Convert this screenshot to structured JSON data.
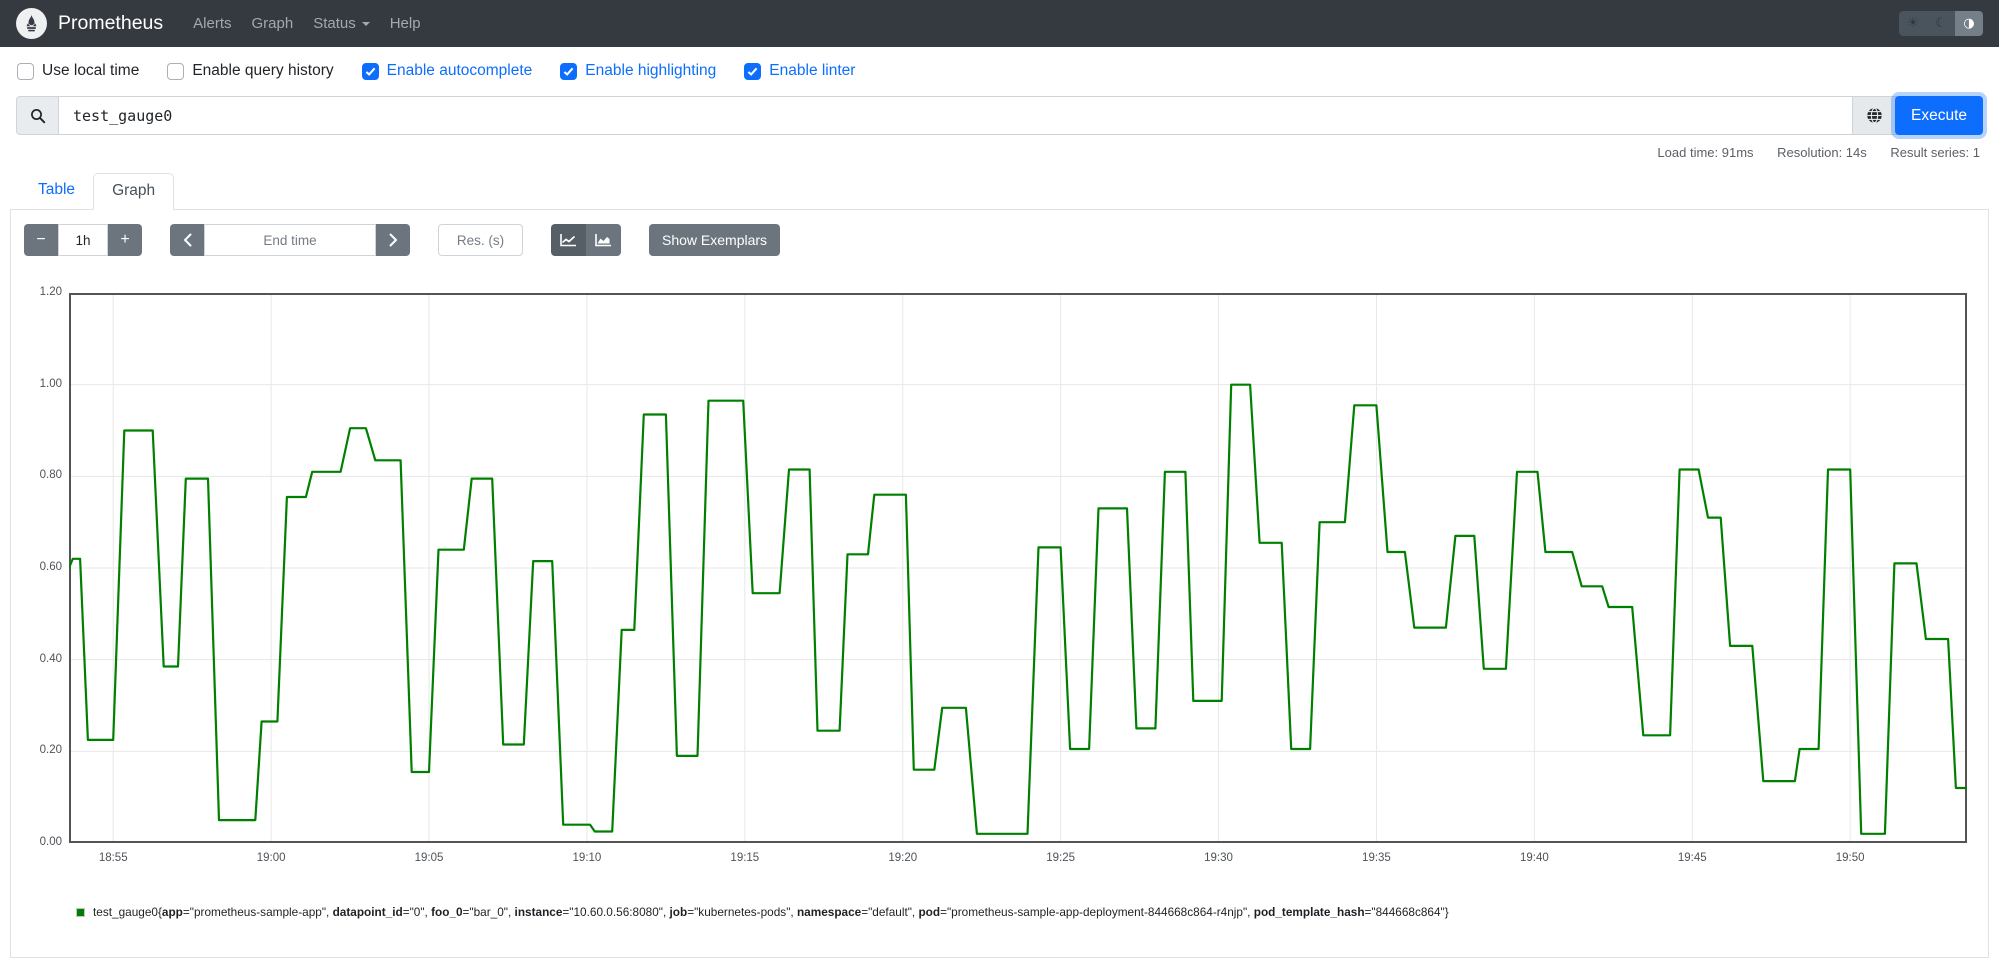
{
  "navbar": {
    "brand": "Prometheus",
    "links": [
      {
        "label": "Alerts"
      },
      {
        "label": "Graph"
      },
      {
        "label": "Status",
        "has_dropdown": true
      },
      {
        "label": "Help"
      }
    ],
    "theme_toggle": {
      "light": "☀",
      "dark": "☾",
      "auto": "◑",
      "active": "auto"
    }
  },
  "toolbar": {
    "checkboxes": [
      {
        "label": "Use local time",
        "checked": false
      },
      {
        "label": "Enable query history",
        "checked": false
      },
      {
        "label": "Enable autocomplete",
        "checked": true
      },
      {
        "label": "Enable highlighting",
        "checked": true
      },
      {
        "label": "Enable linter",
        "checked": true
      }
    ]
  },
  "query": {
    "value": "test_gauge0",
    "execute_label": "Execute"
  },
  "stats": {
    "load_time": "Load time: 91ms",
    "resolution": "Resolution: 14s",
    "result_series": "Result series: 1"
  },
  "tabs": [
    {
      "label": "Table",
      "active": false
    },
    {
      "label": "Graph",
      "active": true
    }
  ],
  "graph_controls": {
    "minus": "−",
    "duration": "1h",
    "plus": "+",
    "end_time_placeholder": "End time",
    "res_placeholder": "Res. (s)",
    "show_exemplars": "Show Exemplars"
  },
  "legend": {
    "metric": "test_gauge0",
    "labels": [
      {
        "name": "app",
        "value": "prometheus-sample-app"
      },
      {
        "name": "datapoint_id",
        "value": "0"
      },
      {
        "name": "foo_0",
        "value": "bar_0"
      },
      {
        "name": "instance",
        "value": "10.60.0.56:8080"
      },
      {
        "name": "job",
        "value": "kubernetes-pods"
      },
      {
        "name": "namespace",
        "value": "default"
      },
      {
        "name": "pod",
        "value": "prometheus-sample-app-deployment-844668c864-r4njp"
      },
      {
        "name": "pod_template_hash",
        "value": "844668c864"
      }
    ]
  },
  "chart_data": {
    "type": "line",
    "style": "step-gauge",
    "series_name": "test_gauge0",
    "series_color": "#008000",
    "x_time_origin": "18:53",
    "x_range": [
      0.6,
      60.7
    ],
    "y_range": [
      0,
      1.2
    ],
    "y_tick_step": 0.2,
    "grid": true,
    "x_ticks": [
      {
        "t": 2,
        "label": "18:55"
      },
      {
        "t": 7,
        "label": "19:00"
      },
      {
        "t": 12,
        "label": "19:05"
      },
      {
        "t": 17,
        "label": "19:10"
      },
      {
        "t": 22,
        "label": "19:15"
      },
      {
        "t": 27,
        "label": "19:20"
      },
      {
        "t": 32,
        "label": "19:25"
      },
      {
        "t": 37,
        "label": "19:30"
      },
      {
        "t": 42,
        "label": "19:35"
      },
      {
        "t": 47,
        "label": "19:40"
      },
      {
        "t": 52,
        "label": "19:45"
      },
      {
        "t": 57,
        "label": "19:50"
      }
    ],
    "points": [
      [
        0.6,
        0.6
      ],
      [
        0.72,
        0.62
      ],
      [
        0.95,
        0.62
      ],
      [
        1.2,
        0.225
      ],
      [
        2.0,
        0.225
      ],
      [
        2.35,
        0.9
      ],
      [
        3.25,
        0.9
      ],
      [
        3.6,
        0.385
      ],
      [
        4.05,
        0.385
      ],
      [
        4.3,
        0.795
      ],
      [
        5.0,
        0.795
      ],
      [
        5.35,
        0.05
      ],
      [
        6.5,
        0.05
      ],
      [
        6.7,
        0.265
      ],
      [
        7.2,
        0.265
      ],
      [
        7.5,
        0.755
      ],
      [
        8.1,
        0.755
      ],
      [
        8.3,
        0.81
      ],
      [
        9.2,
        0.81
      ],
      [
        9.5,
        0.905
      ],
      [
        10.0,
        0.905
      ],
      [
        10.3,
        0.835
      ],
      [
        11.1,
        0.835
      ],
      [
        11.45,
        0.155
      ],
      [
        12.0,
        0.155
      ],
      [
        12.3,
        0.64
      ],
      [
        13.1,
        0.64
      ],
      [
        13.35,
        0.795
      ],
      [
        14.0,
        0.795
      ],
      [
        14.35,
        0.215
      ],
      [
        15.0,
        0.215
      ],
      [
        15.3,
        0.615
      ],
      [
        15.9,
        0.615
      ],
      [
        16.25,
        0.04
      ],
      [
        17.1,
        0.04
      ],
      [
        17.25,
        0.025
      ],
      [
        17.8,
        0.025
      ],
      [
        18.1,
        0.465
      ],
      [
        18.5,
        0.465
      ],
      [
        18.8,
        0.935
      ],
      [
        19.5,
        0.935
      ],
      [
        19.85,
        0.19
      ],
      [
        20.5,
        0.19
      ],
      [
        20.85,
        0.965
      ],
      [
        21.95,
        0.965
      ],
      [
        22.25,
        0.545
      ],
      [
        23.1,
        0.545
      ],
      [
        23.4,
        0.815
      ],
      [
        24.05,
        0.815
      ],
      [
        24.3,
        0.245
      ],
      [
        25.0,
        0.245
      ],
      [
        25.25,
        0.63
      ],
      [
        25.9,
        0.63
      ],
      [
        26.1,
        0.76
      ],
      [
        27.1,
        0.76
      ],
      [
        27.35,
        0.16
      ],
      [
        28.0,
        0.16
      ],
      [
        28.25,
        0.295
      ],
      [
        29.0,
        0.295
      ],
      [
        29.35,
        0.02
      ],
      [
        30.95,
        0.02
      ],
      [
        31.3,
        0.645
      ],
      [
        32.0,
        0.645
      ],
      [
        32.3,
        0.205
      ],
      [
        32.9,
        0.205
      ],
      [
        33.2,
        0.73
      ],
      [
        34.1,
        0.73
      ],
      [
        34.4,
        0.25
      ],
      [
        35.0,
        0.25
      ],
      [
        35.3,
        0.81
      ],
      [
        35.95,
        0.81
      ],
      [
        36.2,
        0.31
      ],
      [
        37.1,
        0.31
      ],
      [
        37.4,
        1.0
      ],
      [
        38.0,
        1.0
      ],
      [
        38.3,
        0.655
      ],
      [
        39.0,
        0.655
      ],
      [
        39.3,
        0.205
      ],
      [
        39.9,
        0.205
      ],
      [
        40.2,
        0.7
      ],
      [
        41.0,
        0.7
      ],
      [
        41.3,
        0.955
      ],
      [
        42.0,
        0.955
      ],
      [
        42.35,
        0.635
      ],
      [
        42.9,
        0.635
      ],
      [
        43.2,
        0.47
      ],
      [
        44.2,
        0.47
      ],
      [
        44.5,
        0.67
      ],
      [
        45.1,
        0.67
      ],
      [
        45.4,
        0.38
      ],
      [
        46.1,
        0.38
      ],
      [
        46.45,
        0.81
      ],
      [
        47.1,
        0.81
      ],
      [
        47.35,
        0.635
      ],
      [
        48.2,
        0.635
      ],
      [
        48.5,
        0.56
      ],
      [
        49.15,
        0.56
      ],
      [
        49.35,
        0.515
      ],
      [
        50.1,
        0.515
      ],
      [
        50.45,
        0.235
      ],
      [
        51.3,
        0.235
      ],
      [
        51.6,
        0.815
      ],
      [
        52.2,
        0.815
      ],
      [
        52.5,
        0.71
      ],
      [
        52.9,
        0.71
      ],
      [
        53.2,
        0.43
      ],
      [
        53.9,
        0.43
      ],
      [
        54.25,
        0.135
      ],
      [
        55.25,
        0.135
      ],
      [
        55.4,
        0.205
      ],
      [
        56.0,
        0.205
      ],
      [
        56.3,
        0.815
      ],
      [
        57.0,
        0.815
      ],
      [
        57.35,
        0.02
      ],
      [
        58.1,
        0.02
      ],
      [
        58.4,
        0.61
      ],
      [
        59.1,
        0.61
      ],
      [
        59.4,
        0.445
      ],
      [
        60.1,
        0.445
      ],
      [
        60.35,
        0.12
      ],
      [
        60.7,
        0.12
      ]
    ]
  },
  "colors": {
    "navbar_bg": "#343a40",
    "accent_blue": "#0d6efd",
    "button_gray": "#6c757d",
    "series_green": "#008000",
    "grid_gray": "#e7e7e7",
    "plot_border": "#545454"
  }
}
